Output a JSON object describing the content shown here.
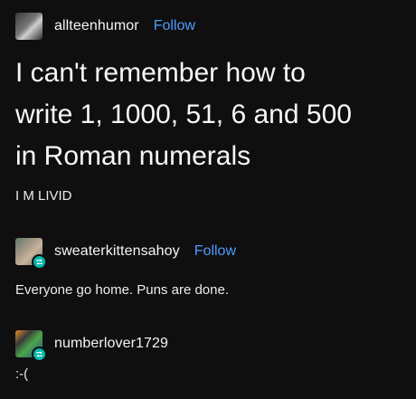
{
  "posts": [
    {
      "username": "allteenhumor",
      "follow_label": "Follow",
      "title_lines": [
        "I can't remember how to",
        "write 1, 1000, 51, 6 and 500",
        "in Roman numerals"
      ],
      "body": "I M LIVID"
    },
    {
      "username": "sweaterkittensahoy",
      "follow_label": "Follow",
      "body": "Everyone go home. Puns are done."
    },
    {
      "username": "numberlover1729",
      "body": ":-("
    }
  ],
  "colors": {
    "background": "#0f0f0f",
    "link": "#4f9cff",
    "reblog_badge": "#00b8a9"
  },
  "icons": [
    "avatar",
    "reblog-icon"
  ]
}
